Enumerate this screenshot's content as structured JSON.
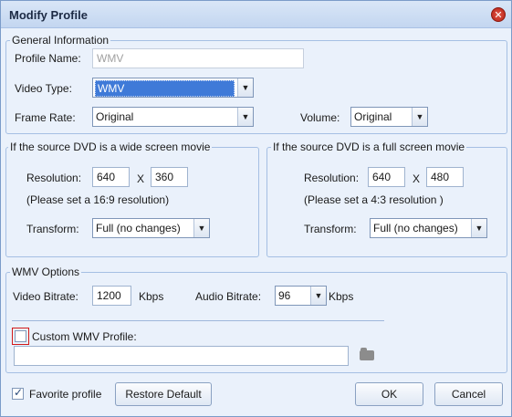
{
  "window": {
    "title": "Modify Profile"
  },
  "general": {
    "legend": "General Information",
    "profile_name_label": "Profile Name:",
    "profile_name_value": "WMV",
    "video_type_label": "Video Type:",
    "video_type_value": "WMV",
    "frame_rate_label": "Frame Rate:",
    "frame_rate_value": "Original",
    "volume_label": "Volume:",
    "volume_value": "Original"
  },
  "wide": {
    "legend": "If the source DVD is a wide screen movie",
    "resolution_label": "Resolution:",
    "width": "640",
    "x_label": "X",
    "height": "360",
    "hint": "(Please set a 16:9 resolution)",
    "transform_label": "Transform:",
    "transform_value": "Full (no changes)"
  },
  "full": {
    "legend": "If the source DVD is a full screen movie",
    "resolution_label": "Resolution:",
    "width": "640",
    "x_label": "X",
    "height": "480",
    "hint": "(Please set a 4:3 resolution )",
    "transform_label": "Transform:",
    "transform_value": "Full (no changes)"
  },
  "wmv": {
    "legend": "WMV Options",
    "video_bitrate_label": "Video Bitrate:",
    "video_bitrate_value": "1200",
    "kbps1": "Kbps",
    "audio_bitrate_label": "Audio Bitrate:",
    "audio_bitrate_value": "96",
    "kbps2": "Kbps",
    "custom_label": "Custom WMV Profile:",
    "custom_checked": false,
    "custom_path": ""
  },
  "footer": {
    "favorite_label": "Favorite profile",
    "favorite_checked": true,
    "restore_label": "Restore Default",
    "ok_label": "OK",
    "cancel_label": "Cancel"
  },
  "icons": {
    "close": "close-icon",
    "dropdown": "chevron-down-icon",
    "folder": "folder-icon",
    "check": "checkmark-icon"
  },
  "colors": {
    "background": "#eaf1fb",
    "selection": "#3f7ad8",
    "highlight": "#d21a1a"
  }
}
